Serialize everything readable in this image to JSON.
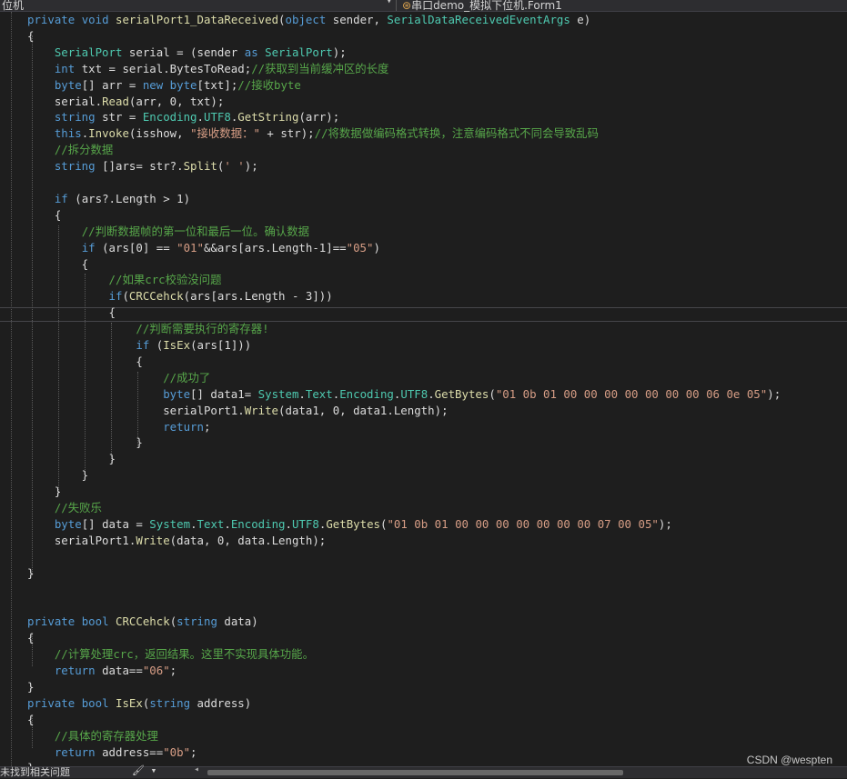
{
  "nav": {
    "left_text": "位机",
    "right_text": "串口demo_模拟下位机.Form1",
    "dropdown_glyph": "▾",
    "class_icon": "class-icon"
  },
  "editor": {
    "lines": [
      [
        [
          "kw",
          "private "
        ],
        [
          "kw",
          "void "
        ],
        [
          "mt",
          "serialPort1_DataReceived"
        ],
        [
          "pl",
          "("
        ],
        [
          "kw",
          "object "
        ],
        [
          "pl",
          "sender, "
        ],
        [
          "ty",
          "SerialDataReceivedEventArgs "
        ],
        [
          "pl",
          "e)"
        ]
      ],
      [
        [
          "pl",
          "{"
        ]
      ],
      [
        [
          "pl",
          "    "
        ],
        [
          "ty",
          "SerialPort "
        ],
        [
          "pl",
          "serial = (sender "
        ],
        [
          "kw",
          "as "
        ],
        [
          "ty",
          "SerialPort"
        ],
        [
          "pl",
          ");"
        ]
      ],
      [
        [
          "pl",
          "    "
        ],
        [
          "kw",
          "int "
        ],
        [
          "pl",
          "txt = serial."
        ],
        [
          "pl",
          "BytesToRead;"
        ],
        [
          "cm",
          "//获取到当前缓冲区的长度"
        ]
      ],
      [
        [
          "pl",
          "    "
        ],
        [
          "kw",
          "byte"
        ],
        [
          "pl",
          "[] arr = "
        ],
        [
          "kw",
          "new "
        ],
        [
          "kw",
          "byte"
        ],
        [
          "pl",
          "[txt];"
        ],
        [
          "cm",
          "//接收byte"
        ]
      ],
      [
        [
          "pl",
          "    serial."
        ],
        [
          "mt",
          "Read"
        ],
        [
          "pl",
          "(arr, 0, txt);"
        ]
      ],
      [
        [
          "pl",
          "    "
        ],
        [
          "kw",
          "string "
        ],
        [
          "pl",
          "str = "
        ],
        [
          "ty",
          "Encoding"
        ],
        [
          "pl",
          "."
        ],
        [
          "ty",
          "UTF8"
        ],
        [
          "pl",
          "."
        ],
        [
          "mt",
          "GetString"
        ],
        [
          "pl",
          "(arr);"
        ]
      ],
      [
        [
          "pl",
          "    "
        ],
        [
          "kw",
          "this"
        ],
        [
          "pl",
          "."
        ],
        [
          "mt",
          "Invoke"
        ],
        [
          "pl",
          "(isshow, "
        ],
        [
          "st",
          "\"接收数据：\""
        ],
        [
          "pl",
          " + str);"
        ],
        [
          "cm",
          "//将数据做编码格式转换，注意编码格式不同会导致乱码"
        ]
      ],
      [
        [
          "pl",
          "    "
        ],
        [
          "cm",
          "//拆分数据"
        ]
      ],
      [
        [
          "pl",
          "    "
        ],
        [
          "kw",
          "string "
        ],
        [
          "pl",
          "[]ars= str?."
        ],
        [
          "mt",
          "Split"
        ],
        [
          "pl",
          "("
        ],
        [
          "st",
          "' '"
        ],
        [
          "pl",
          ");"
        ]
      ],
      [
        [
          "pl",
          ""
        ]
      ],
      [
        [
          "pl",
          "    "
        ],
        [
          "kw",
          "if "
        ],
        [
          "pl",
          "(ars?.Length > 1)"
        ]
      ],
      [
        [
          "pl",
          "    {"
        ]
      ],
      [
        [
          "pl",
          "        "
        ],
        [
          "cm",
          "//判断数据帧的第一位和最后一位。确认数据"
        ]
      ],
      [
        [
          "pl",
          "        "
        ],
        [
          "kw",
          "if "
        ],
        [
          "pl",
          "(ars[0] == "
        ],
        [
          "st",
          "\"01\""
        ],
        [
          "pl",
          "&&ars[ars.Length-1]=="
        ],
        [
          "st",
          "\"05\""
        ],
        [
          "pl",
          ")"
        ]
      ],
      [
        [
          "pl",
          "        {"
        ]
      ],
      [
        [
          "pl",
          "            "
        ],
        [
          "cm",
          "//如果crc校验没问题"
        ]
      ],
      [
        [
          "pl",
          "            "
        ],
        [
          "kw",
          "if"
        ],
        [
          "pl",
          "("
        ],
        [
          "mt",
          "CRCCehck"
        ],
        [
          "pl",
          "(ars[ars.Length - 3]))"
        ]
      ],
      [
        [
          "pl",
          "            {"
        ]
      ],
      [
        [
          "pl",
          "                "
        ],
        [
          "cm",
          "//判断需要执行的寄存器!"
        ]
      ],
      [
        [
          "pl",
          "                "
        ],
        [
          "kw",
          "if "
        ],
        [
          "pl",
          "("
        ],
        [
          "mt",
          "IsEx"
        ],
        [
          "pl",
          "(ars[1]))"
        ]
      ],
      [
        [
          "pl",
          "                {"
        ]
      ],
      [
        [
          "pl",
          "                    "
        ],
        [
          "cm",
          "//成功了"
        ]
      ],
      [
        [
          "pl",
          "                    "
        ],
        [
          "kw",
          "byte"
        ],
        [
          "pl",
          "[] data1= "
        ],
        [
          "ty",
          "System"
        ],
        [
          "pl",
          "."
        ],
        [
          "ty",
          "Text"
        ],
        [
          "pl",
          "."
        ],
        [
          "ty",
          "Encoding"
        ],
        [
          "pl",
          "."
        ],
        [
          "ty",
          "UTF8"
        ],
        [
          "pl",
          "."
        ],
        [
          "mt",
          "GetBytes"
        ],
        [
          "pl",
          "("
        ],
        [
          "st",
          "\"01 0b 01 00 00 00 00 00 00 00 06 0e 05\""
        ],
        [
          "pl",
          ");"
        ]
      ],
      [
        [
          "pl",
          "                    serialPort1."
        ],
        [
          "mt",
          "Write"
        ],
        [
          "pl",
          "(data1, 0, data1.Length);"
        ]
      ],
      [
        [
          "pl",
          "                    "
        ],
        [
          "kw",
          "return"
        ],
        [
          "pl",
          ";"
        ]
      ],
      [
        [
          "pl",
          "                }"
        ]
      ],
      [
        [
          "pl",
          "            }"
        ]
      ],
      [
        [
          "pl",
          "        }"
        ]
      ],
      [
        [
          "pl",
          "    }"
        ]
      ],
      [
        [
          "pl",
          "    "
        ],
        [
          "cm",
          "//失败乐"
        ]
      ],
      [
        [
          "pl",
          "    "
        ],
        [
          "kw",
          "byte"
        ],
        [
          "pl",
          "[] data = "
        ],
        [
          "ty",
          "System"
        ],
        [
          "pl",
          "."
        ],
        [
          "ty",
          "Text"
        ],
        [
          "pl",
          "."
        ],
        [
          "ty",
          "Encoding"
        ],
        [
          "pl",
          "."
        ],
        [
          "ty",
          "UTF8"
        ],
        [
          "pl",
          "."
        ],
        [
          "mt",
          "GetBytes"
        ],
        [
          "pl",
          "("
        ],
        [
          "st",
          "\"01 0b 01 00 00 00 00 00 00 00 07 00 05\""
        ],
        [
          "pl",
          ");"
        ]
      ],
      [
        [
          "pl",
          "    serialPort1."
        ],
        [
          "mt",
          "Write"
        ],
        [
          "pl",
          "(data, 0, data.Length);"
        ]
      ],
      [
        [
          "pl",
          ""
        ]
      ],
      [
        [
          "pl",
          "}"
        ]
      ],
      [
        [
          "pl",
          ""
        ]
      ],
      [
        [
          "pl",
          ""
        ]
      ],
      [
        [
          "kw",
          "private "
        ],
        [
          "kw",
          "bool "
        ],
        [
          "mt",
          "CRCCehck"
        ],
        [
          "pl",
          "("
        ],
        [
          "kw",
          "string "
        ],
        [
          "pl",
          "data)"
        ]
      ],
      [
        [
          "pl",
          "{"
        ]
      ],
      [
        [
          "pl",
          "    "
        ],
        [
          "cm",
          "//计算处理crc，返回结果。这里不实现具体功能。"
        ]
      ],
      [
        [
          "pl",
          "    "
        ],
        [
          "kw",
          "return "
        ],
        [
          "pl",
          "data=="
        ],
        [
          "st",
          "\"06\""
        ],
        [
          "pl",
          ";"
        ]
      ],
      [
        [
          "pl",
          "}"
        ]
      ],
      [
        [
          "kw",
          "private "
        ],
        [
          "kw",
          "bool "
        ],
        [
          "mt",
          "IsEx"
        ],
        [
          "pl",
          "("
        ],
        [
          "kw",
          "string "
        ],
        [
          "pl",
          "address)"
        ]
      ],
      [
        [
          "pl",
          "{"
        ]
      ],
      [
        [
          "pl",
          "    "
        ],
        [
          "cm",
          "//具体的寄存器处理"
        ]
      ],
      [
        [
          "pl",
          "    "
        ],
        [
          "kw",
          "return "
        ],
        [
          "pl",
          "address=="
        ],
        [
          "st",
          "\"0b\""
        ],
        [
          "pl",
          ";"
        ]
      ],
      [
        [
          "pl",
          "}"
        ]
      ]
    ]
  },
  "status": {
    "message": "未找到相关问题",
    "tools_glyph": "🖌 ▾",
    "arrow_glyph": "◂"
  },
  "watermark": "CSDN @wespten",
  "colors": {
    "background": "#1e1e1e",
    "keyword": "#569cd6",
    "type": "#4ec9b0",
    "comment": "#57a64a",
    "string": "#d69d85",
    "method": "#dcdcaa"
  }
}
